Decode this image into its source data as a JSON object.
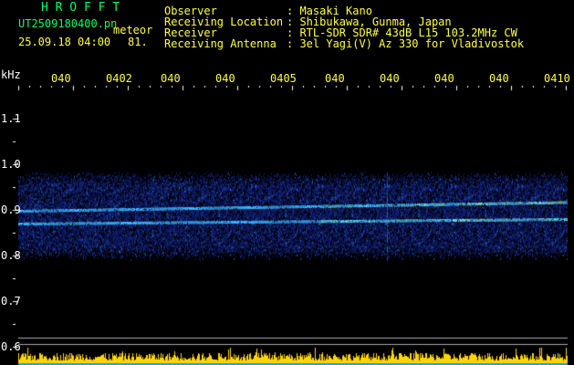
{
  "header": {
    "title": "H R O F F T",
    "filename": "UT2509180400.pn",
    "mode": "meteor",
    "datetime": "25.09.18 04:00",
    "count": "81.",
    "fields": [
      {
        "label": "Observer",
        "value": ": Masaki Kano"
      },
      {
        "label": "Receiving Location",
        "value": ": Shibukawa, Gunma, Japan"
      },
      {
        "label": "Receiver",
        "value": ": RTL-SDR SDR# 43dB L15 103.2MHz CW"
      },
      {
        "label": "Receiving Antenna",
        "value": ": 3el Yagi(V) Az 330 for Vladivostok"
      }
    ]
  },
  "time_axis": {
    "labels": [
      "040",
      "0402",
      "040",
      "040",
      "0405",
      "040",
      "040",
      "040",
      "040",
      "0410"
    ]
  },
  "freq_axis": {
    "unit": "kHz",
    "labels": [
      "1.1",
      "1.0",
      "0.9",
      "0.8",
      "0.7",
      "0.6"
    ]
  },
  "colors": {
    "background": "#000000",
    "title": "#00ff66",
    "text": "#ffff44",
    "axis": "#ffffff",
    "noise_low": "#1a2fb0",
    "noise_mid": "#2f8cff",
    "signal_hot": "#ffd000",
    "baseline": "#ffd400",
    "baseline_ref": "#00aaff"
  }
}
